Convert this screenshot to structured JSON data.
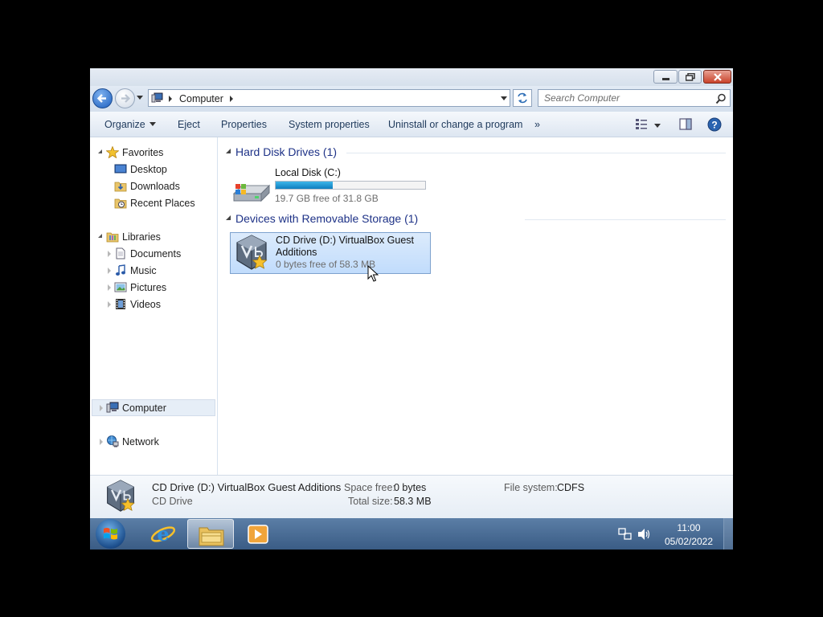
{
  "window": {
    "buttons": [
      "minimize",
      "maximize",
      "close"
    ]
  },
  "address_bar": {
    "crumb": "Computer",
    "search_placeholder": "Search Computer"
  },
  "toolbar": {
    "items": [
      "Organize",
      "Eject",
      "Properties",
      "System properties",
      "Uninstall or change a program"
    ],
    "more": "»"
  },
  "sidebar": {
    "favorites": {
      "label": "Favorites",
      "items": [
        "Desktop",
        "Downloads",
        "Recent Places"
      ]
    },
    "libraries": {
      "label": "Libraries",
      "items": [
        "Documents",
        "Music",
        "Pictures",
        "Videos"
      ]
    },
    "computer": {
      "label": "Computer",
      "selected": true
    },
    "network": {
      "label": "Network"
    }
  },
  "content": {
    "groups": [
      {
        "header": "Hard Disk Drives (1)",
        "drives": [
          {
            "name": "Local Disk (C:)",
            "free": "19.7 GB free of 31.8 GB",
            "used_fraction": 0.38,
            "icon": "hard-disk-icon"
          }
        ]
      },
      {
        "header": "Devices with Removable Storage (1)",
        "drives": [
          {
            "name": "CD Drive (D:) VirtualBox Guest Additions",
            "free": "0 bytes free of 58.3 MB",
            "selected": true,
            "icon": "virtualbox-cd-icon"
          }
        ]
      }
    ]
  },
  "details_pane": {
    "title": "CD Drive (D:) VirtualBox Guest Additions",
    "subtitle": "CD Drive",
    "space_free_label": "Space free:",
    "space_free": "0 bytes",
    "total_size_label": "Total size:",
    "total_size": "58.3 MB",
    "file_system_label": "File system:",
    "file_system": "CDFS"
  },
  "taskbar": {
    "pinned": [
      "internet-explorer-icon",
      "windows-explorer-icon",
      "media-player-icon"
    ],
    "active": "windows-explorer-icon",
    "time": "11:00",
    "date": "05/02/2022"
  },
  "colors": {
    "group_header": "#1e3287",
    "toolbar_text": "#1e395b",
    "selection": "#c1dcfc",
    "taskbar": "#3a5c85"
  }
}
